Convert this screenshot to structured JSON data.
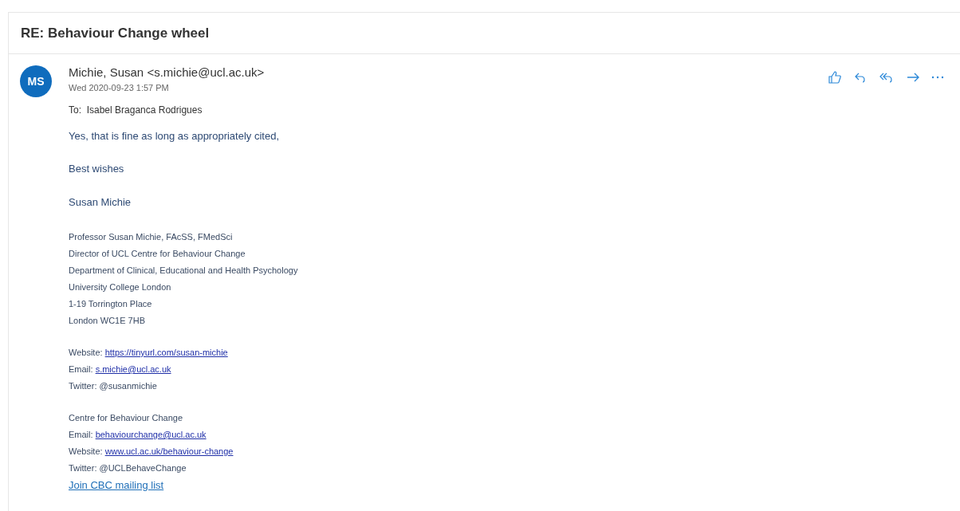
{
  "subject": "RE: Behaviour Change wheel",
  "message": {
    "avatar_initials": "MS",
    "sender": "Michie, Susan <s.michie@ucl.ac.uk>",
    "date": "Wed 2020-09-23 1:57 PM",
    "to": "To:  Isabel Braganca Rodrigues",
    "body": [
      "Yes, that is fine as long as appropriately cited,",
      "Best wishes",
      "Susan Michie"
    ],
    "signature_blocks": [
      [
        [
          {
            "kind": "text",
            "text": "Professor Susan Michie, FAcSS, FMedSci"
          }
        ],
        [
          {
            "kind": "text",
            "text": "Director of UCL Centre for Behaviour Change"
          }
        ],
        [
          {
            "kind": "text",
            "text": "Department of Clinical, Educational and Health Psychology"
          }
        ],
        [
          {
            "kind": "text",
            "text": "University College London"
          }
        ],
        [
          {
            "kind": "text",
            "text": "1-19 Torrington Place"
          }
        ],
        [
          {
            "kind": "text",
            "text": "London WC1E 7HB"
          }
        ]
      ],
      [
        [
          {
            "kind": "text",
            "text": "Website: "
          },
          {
            "kind": "link",
            "text": "https://tinyurl.com/susan-michie"
          }
        ],
        [
          {
            "kind": "text",
            "text": "Email: "
          },
          {
            "kind": "link",
            "text": "s.michie@ucl.ac.uk"
          }
        ],
        [
          {
            "kind": "text",
            "text": "Twitter: @susanmichie"
          }
        ]
      ],
      [
        [
          {
            "kind": "text",
            "text": "Centre for Behaviour Change"
          }
        ],
        [
          {
            "kind": "text",
            "text": "Email: "
          },
          {
            "kind": "link",
            "text": "behaviourchange@ucl.ac.uk"
          }
        ],
        [
          {
            "kind": "text",
            "text": "Website: "
          },
          {
            "kind": "link",
            "text": "www.ucl.ac.uk/behaviour-change"
          }
        ],
        [
          {
            "kind": "text",
            "text": "Twitter: @UCLBehaveChange"
          }
        ],
        [
          {
            "kind": "big_link",
            "text": "Join CBC mailing list"
          }
        ]
      ]
    ]
  }
}
